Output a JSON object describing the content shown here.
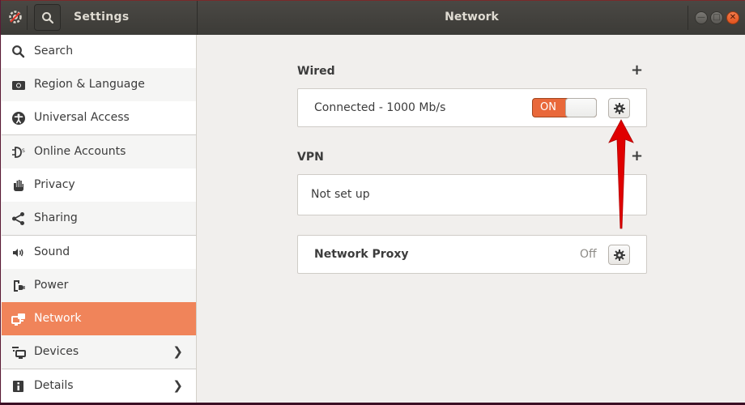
{
  "titlebar": {
    "app_title": "Settings",
    "panel_title": "Network",
    "icons": {
      "app": "settings-app-icon",
      "search": "search-icon",
      "minimize": "minimize-icon",
      "maximize": "maximize-icon",
      "close": "close-icon"
    }
  },
  "sidebar": {
    "items": [
      {
        "label": "Search",
        "icon": "search-icon"
      },
      {
        "label": "Region & Language",
        "icon": "region-flag-icon"
      },
      {
        "label": "Universal Access",
        "icon": "accessibility-icon"
      },
      {
        "label": "Online Accounts",
        "icon": "online-accounts-icon"
      },
      {
        "label": "Privacy",
        "icon": "hand-icon"
      },
      {
        "label": "Sharing",
        "icon": "share-icon"
      },
      {
        "label": "Sound",
        "icon": "speaker-icon"
      },
      {
        "label": "Power",
        "icon": "power-plug-icon"
      },
      {
        "label": "Network",
        "icon": "network-icon",
        "active": true
      },
      {
        "label": "Devices",
        "icon": "devices-icon",
        "chevron": true
      },
      {
        "label": "Details",
        "icon": "info-icon",
        "chevron": true
      }
    ],
    "active_color": "#f0845a"
  },
  "main": {
    "wired": {
      "title": "Wired",
      "add_label": "+",
      "status": "Connected - 1000 Mb/s",
      "toggle_label": "ON",
      "toggle_state": true
    },
    "vpn": {
      "title": "VPN",
      "add_label": "+",
      "status": "Not set up"
    },
    "proxy": {
      "title": "Network Proxy",
      "status": "Off"
    },
    "annotation": {
      "type": "arrow",
      "color": "#e00000",
      "points_to": "wired-settings-button"
    }
  }
}
